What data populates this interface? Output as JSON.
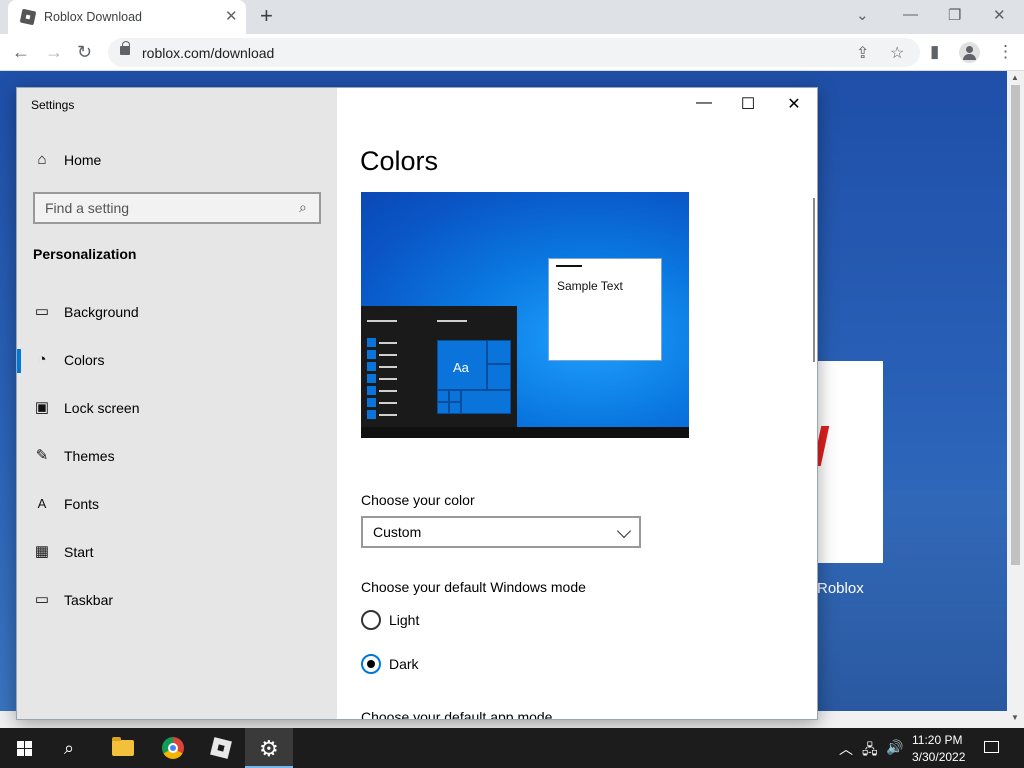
{
  "browser": {
    "tab_title": "Roblox Download",
    "tab_close": "✕",
    "new_tab": "+",
    "minimize": "—",
    "restore": "❐",
    "close": "✕",
    "tab_search": "⌄",
    "back": "←",
    "forward": "→",
    "reload": "↻",
    "url": "roblox.com/download",
    "share_icon": "⇪",
    "bookmark_icon": "☆",
    "sidepanel_icon": "▮",
    "menu_icon": "⋮"
  },
  "page": {
    "roblox_label": "Roblox"
  },
  "settings": {
    "window_title": "Settings",
    "home_label": "Home",
    "search_placeholder": "Find a setting",
    "section_title": "Personalization",
    "nav_items": [
      {
        "label": "Background",
        "icon": "image-icon"
      },
      {
        "label": "Colors",
        "icon": "palette-icon"
      },
      {
        "label": "Lock screen",
        "icon": "lock-screen-icon"
      },
      {
        "label": "Themes",
        "icon": "brush-icon"
      },
      {
        "label": "Fonts",
        "icon": "font-icon"
      },
      {
        "label": "Start",
        "icon": "start-icon"
      },
      {
        "label": "Taskbar",
        "icon": "taskbar-icon"
      }
    ],
    "active_item": "Colors",
    "minimize": "—",
    "maximize": "☐",
    "close": "✕",
    "page_title": "Colors",
    "preview": {
      "sample_text": "Sample Text",
      "tile_text": "Aa"
    },
    "choose_color_label": "Choose your color",
    "choose_color_value": "Custom",
    "windows_mode_label": "Choose your default Windows mode",
    "mode_options": [
      {
        "label": "Light",
        "checked": false
      },
      {
        "label": "Dark",
        "checked": true
      }
    ],
    "app_mode_label": "Choose your default app mode"
  },
  "taskbar": {
    "time": "11:20 PM",
    "date": "3/30/2022",
    "tray_chevron": "︿",
    "network_icon": "🖧",
    "volume_icon": "🔊"
  },
  "colors": {
    "accent": "#0078d7",
    "desktop_blue": "#1e4fa5",
    "taskbar": "#1c1c1c"
  }
}
